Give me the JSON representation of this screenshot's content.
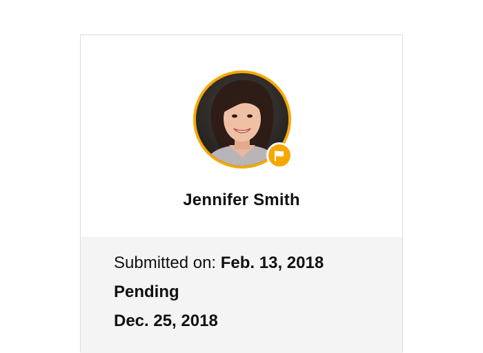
{
  "profile": {
    "name": "Jennifer Smith",
    "avatar_alt": "profile-photo",
    "badge_icon": "flag-icon",
    "accent_color": "#f5a800"
  },
  "submission": {
    "submitted_label": "Submitted on:",
    "submitted_date": "Feb. 13, 2018",
    "status": "Pending",
    "due_date": "Dec. 25, 2018"
  }
}
